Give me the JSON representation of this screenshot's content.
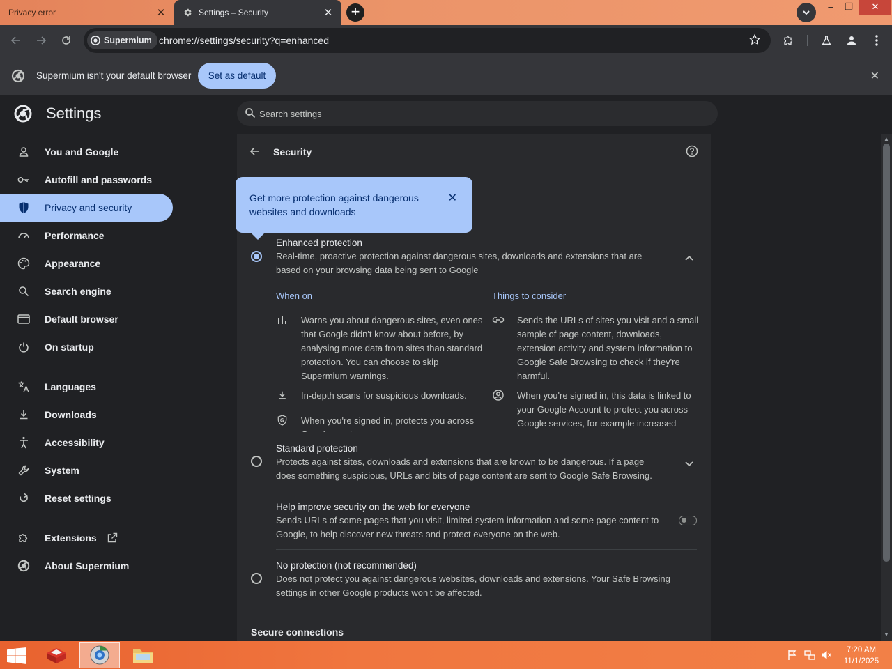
{
  "tabs": [
    {
      "title": "Privacy error",
      "close": "✕"
    },
    {
      "title": "Settings – Security",
      "close": "✕"
    }
  ],
  "window": {
    "new_tab": "+",
    "minimize": "–",
    "restore": "❐",
    "close": "✕"
  },
  "omnibox": {
    "site_chip": "Supermium",
    "url": "chrome://settings/security?q=enhanced"
  },
  "infobar": {
    "text": "Supermium isn't your default browser",
    "button": "Set as default",
    "close": "✕"
  },
  "settings": {
    "title": "Settings",
    "search_placeholder": "Search settings"
  },
  "sidebar": {
    "items": [
      {
        "label": "You and Google",
        "icon": "person-icon"
      },
      {
        "label": "Autofill and passwords",
        "icon": "key-icon"
      },
      {
        "label": "Privacy and security",
        "icon": "shield-icon"
      },
      {
        "label": "Performance",
        "icon": "speedometer-icon"
      },
      {
        "label": "Appearance",
        "icon": "palette-icon"
      },
      {
        "label": "Search engine",
        "icon": "search-icon"
      },
      {
        "label": "Default browser",
        "icon": "browser-window-icon"
      },
      {
        "label": "On startup",
        "icon": "power-icon"
      },
      {
        "label": "Languages",
        "icon": "translate-icon"
      },
      {
        "label": "Downloads",
        "icon": "download-icon"
      },
      {
        "label": "Accessibility",
        "icon": "accessibility-icon"
      },
      {
        "label": "System",
        "icon": "wrench-icon"
      },
      {
        "label": "Reset settings",
        "icon": "reset-icon"
      },
      {
        "label": "Extensions",
        "icon": "puzzle-icon"
      },
      {
        "label": "About Supermium",
        "icon": "supermium-logo-icon"
      }
    ]
  },
  "security": {
    "title": "Security",
    "bubble": {
      "text": "Get more protection against dangerous websites and downloads",
      "close": "✕"
    },
    "enhanced": {
      "title": "Enhanced protection",
      "desc": "Real-time, proactive protection against dangerous sites, downloads and extensions that are based on your browsing data being sent to Google",
      "selected": true,
      "when_on_head": "When on",
      "consider_head": "Things to consider",
      "when_on": [
        "Warns you about dangerous sites, even ones that Google didn't know about before, by analysing more data from sites than standard protection. You can choose to skip Supermium warnings.",
        "In-depth scans for suspicious downloads.",
        "When you're signed in, protects you across Google services."
      ],
      "consider": [
        "Sends the URLs of sites you visit and a small sample of page content, downloads, extension activity and system information to Google Safe Browsing to check if they're harmful.",
        "When you're signed in, this data is linked to your Google Account to protect you across Google services, for example increased"
      ]
    },
    "standard": {
      "title": "Standard protection",
      "desc": "Protects against sites, downloads and extensions that are known to be dangerous. If a page does something suspicious, URLs and bits of page content are sent to Google Safe Browsing.",
      "selected": false
    },
    "help_improve": {
      "title": "Help improve security on the web for everyone",
      "desc": "Sends URLs of some pages that you visit, limited system information and some page content to Google, to help discover new threats and protect everyone on the web.",
      "enabled": false
    },
    "no_protection": {
      "title": "No protection (not recommended)",
      "desc": "Does not protect you against dangerous websites, downloads and extensions. Your Safe Browsing settings in other Google products won't be affected.",
      "selected": false
    },
    "secure_connections": "Secure connections"
  },
  "taskbar": {
    "time": "7:20 AM",
    "date": "11/1/2025"
  },
  "colors": {
    "accent": "#a8c7fa",
    "accent_text": "#062e6f",
    "titlebar": "#eb9469",
    "taskbar": "#f0763f"
  }
}
